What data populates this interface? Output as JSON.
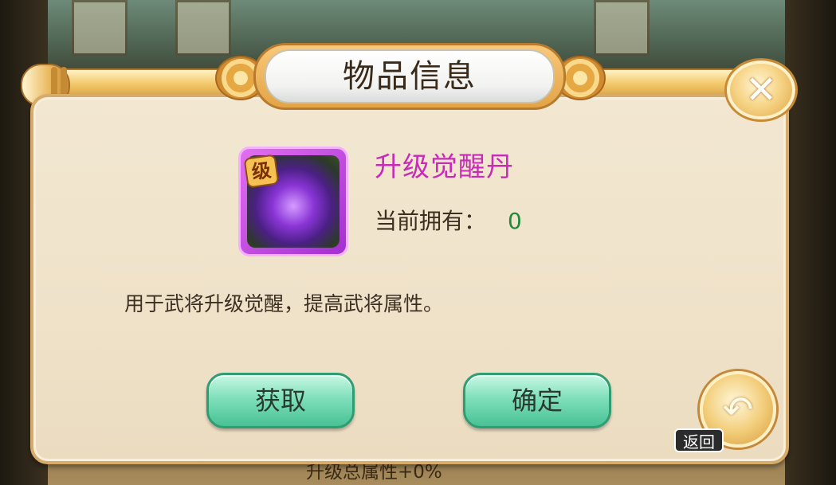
{
  "dialog": {
    "title": "物品信息",
    "close_symbol": "✕",
    "close_icon": "close-icon"
  },
  "item": {
    "name": "升级觉醒丹",
    "name_color": "#c72bb8",
    "badge_text": "级",
    "icon": "purple-orb-icon",
    "owned_label": "当前拥有：",
    "owned_count": "0",
    "owned_color": "#1f8a3a",
    "description": "用于武将升级觉醒，提高武将属性。"
  },
  "buttons": {
    "get_label": "获取",
    "confirm_label": "确定",
    "return_label": "返回",
    "return_symbol": "↶",
    "return_icon": "return-arrow-icon"
  },
  "background": {
    "stat_text": "升级总属性+0%"
  }
}
